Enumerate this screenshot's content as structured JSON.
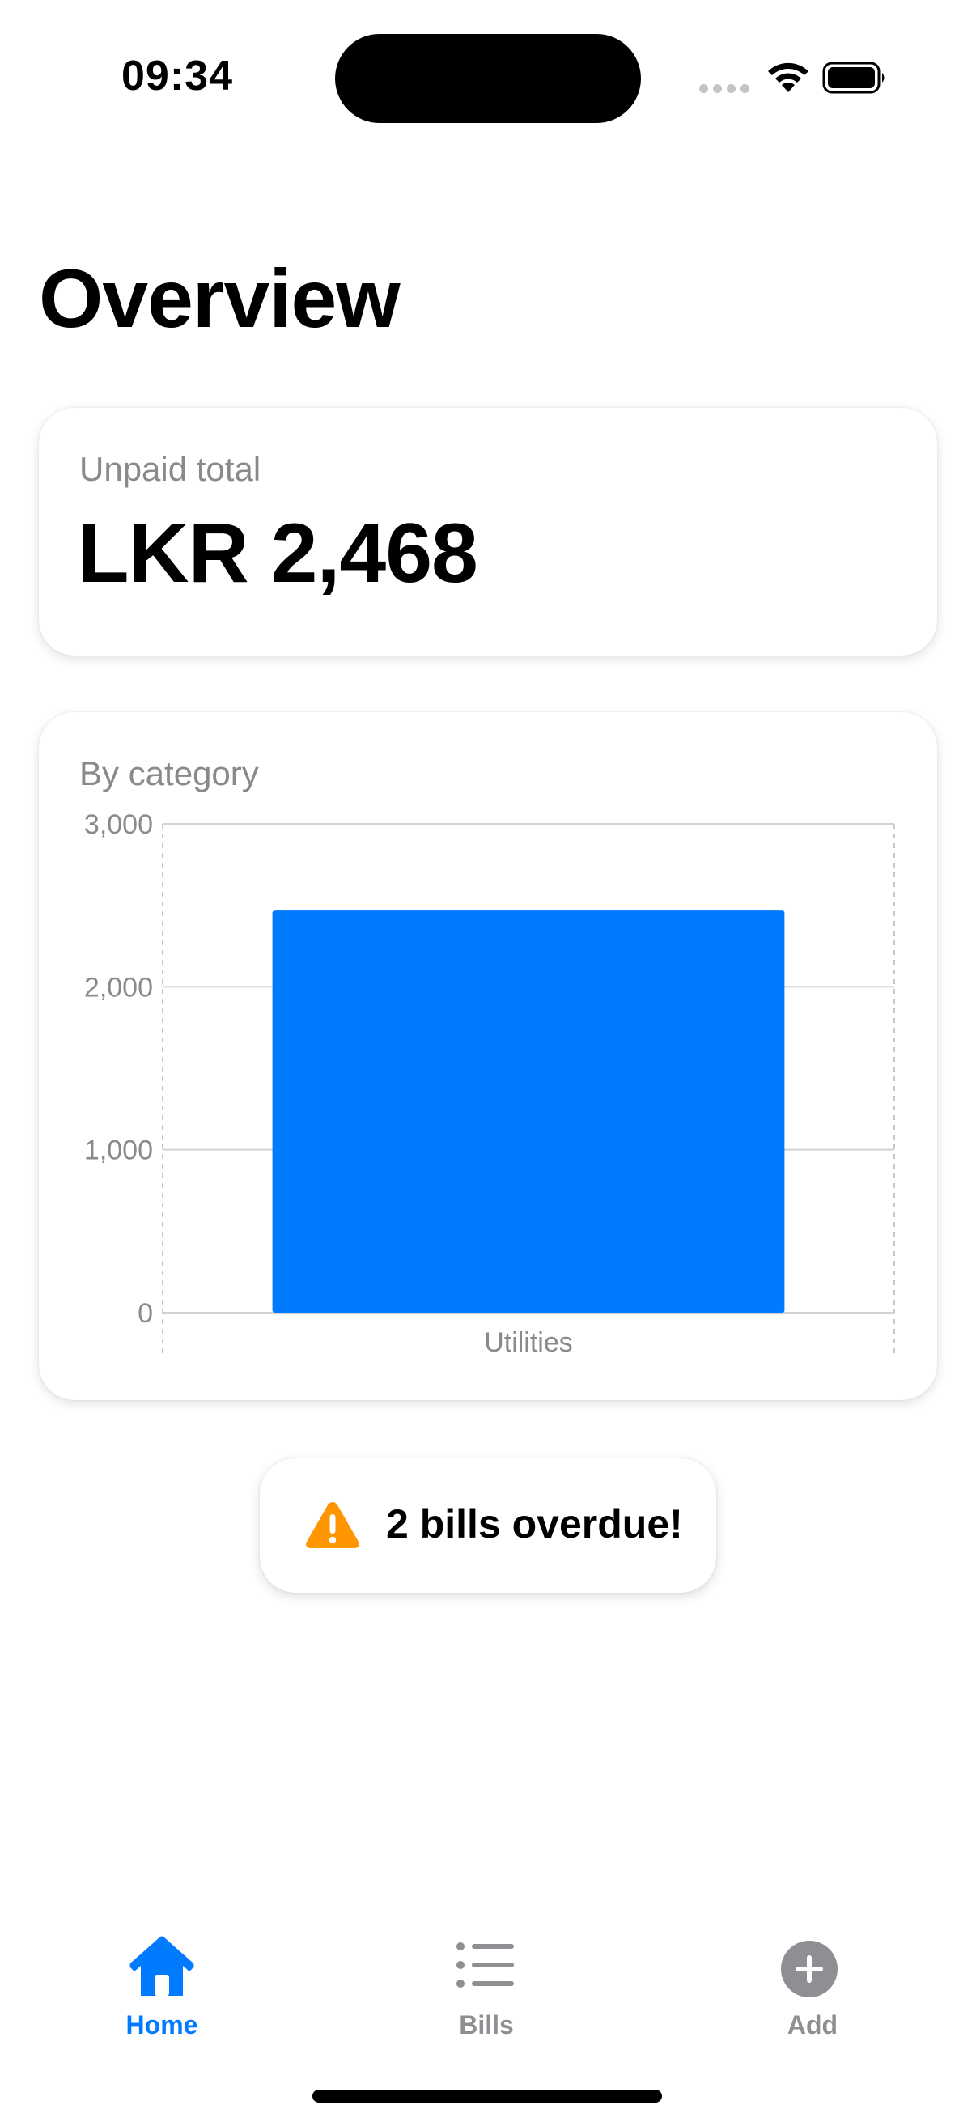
{
  "status_bar": {
    "time": "09:34"
  },
  "page": {
    "title": "Overview"
  },
  "summary": {
    "caption": "Unpaid total",
    "amount": "LKR 2,468"
  },
  "chart": {
    "caption": "By category"
  },
  "chart_data": {
    "type": "bar",
    "categories": [
      "Utilities"
    ],
    "values": [
      2468
    ],
    "ylim": [
      0,
      3000
    ],
    "yticks": [
      0,
      1000,
      2000,
      3000
    ],
    "ytick_labels": [
      "0",
      "1,000",
      "2,000",
      "3,000"
    ],
    "grid": true,
    "bar_color": "#007aff"
  },
  "alert": {
    "icon": "warning-icon",
    "text": "2 bills overdue!",
    "icon_color": "#ff9500"
  },
  "tab_bar": {
    "items": [
      {
        "label": "Home",
        "icon": "house-icon",
        "active": true
      },
      {
        "label": "Bills",
        "icon": "list-icon",
        "active": false
      },
      {
        "label": "Add",
        "icon": "plus-circle-icon",
        "active": false
      }
    ],
    "active_color": "#007aff",
    "inactive_color": "#8e8e93"
  }
}
